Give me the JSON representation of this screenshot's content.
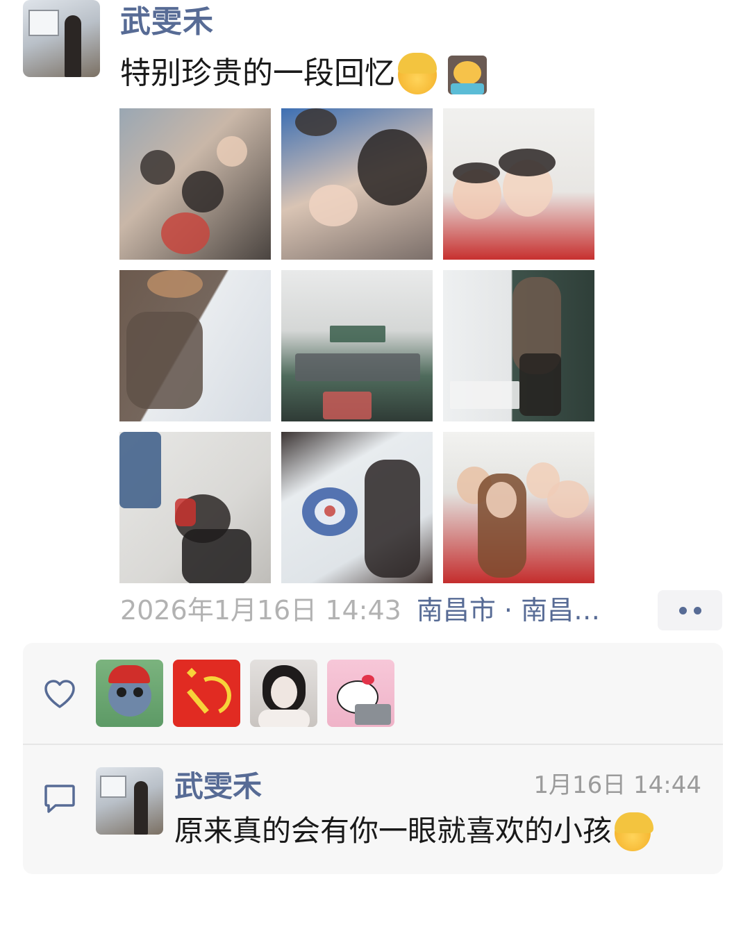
{
  "post": {
    "author": "武雯禾",
    "text": "特别珍贵的一段回忆",
    "emojis": [
      "girl-emoji",
      "teacher-emoji"
    ],
    "photo_count": 9,
    "timestamp": "2026年1月16日 14:43",
    "location": "南昌市 · 南昌…"
  },
  "likes": {
    "icon": "heart-icon",
    "avatars": [
      "stitch-avatar",
      "red-flag-avatar",
      "woman-portrait-avatar",
      "hello-kitty-avatar"
    ]
  },
  "comments": [
    {
      "author": "武雯禾",
      "time": "1月16日 14:44",
      "text": "原来真的会有你一眼就喜欢的小孩",
      "emoji": "girl-emoji"
    }
  ],
  "colors": {
    "link_blue": "#576b95",
    "time_gray": "#b2b2b2",
    "panel_bg": "#f7f7f7"
  }
}
